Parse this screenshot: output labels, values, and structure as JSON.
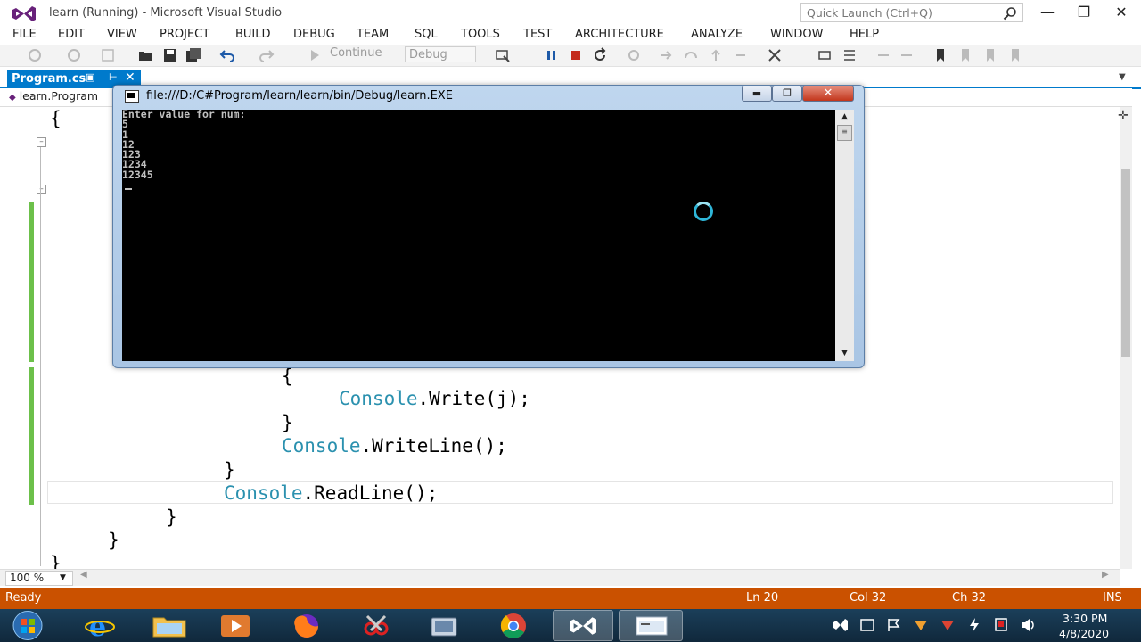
{
  "window": {
    "title": "learn (Running) - Microsoft Visual Studio",
    "quick_launch_placeholder": "Quick Launch (Ctrl+Q)"
  },
  "menu": [
    "FILE",
    "EDIT",
    "VIEW",
    "PROJECT",
    "BUILD",
    "DEBUG",
    "TEAM",
    "SQL",
    "TOOLS",
    "TEST",
    "ARCHITECTURE",
    "ANALYZE",
    "WINDOW",
    "HELP"
  ],
  "toolbar": {
    "continue_label": "Continue",
    "config_value": "Debug"
  },
  "tabs": {
    "active": "Program.cs",
    "nav_class": "learn.Program"
  },
  "code": {
    "lines": [
      {
        "text": "{"
      },
      {
        "text": "{"
      },
      {
        "type": "Console",
        "rest": ".Write(j);"
      },
      {
        "text": "}"
      },
      {
        "type": "Console",
        "rest": ".WriteLine();"
      },
      {
        "text": "}"
      },
      {
        "type": "Console",
        "rest": ".ReadLine();"
      },
      {
        "text": "}"
      },
      {
        "text": "}"
      },
      {
        "text": "}"
      }
    ]
  },
  "console": {
    "title": "file:///D:/C#Program/learn/learn/bin/Debug/learn.EXE",
    "output": "Enter value for num:\n5\n1\n12\n123\n1234\n12345"
  },
  "editor_footer": {
    "zoom": "100 %"
  },
  "status": {
    "state": "Ready",
    "ln": "Ln 20",
    "col": "Col 32",
    "ch": "Ch 32",
    "mode": "INS"
  },
  "taskbar": {
    "time": "3:30 PM",
    "date": "4/8/2020",
    "apps": [
      "start",
      "internet-explorer",
      "file-explorer",
      "media-player",
      "firefox",
      "snipping-tool",
      "camera",
      "chrome",
      "visual-studio",
      "console-window"
    ]
  },
  "colors": {
    "accent": "#007acc",
    "status_bar": "#ca5100",
    "code_type": "#2b91af",
    "change_marker": "#6cc04a"
  }
}
